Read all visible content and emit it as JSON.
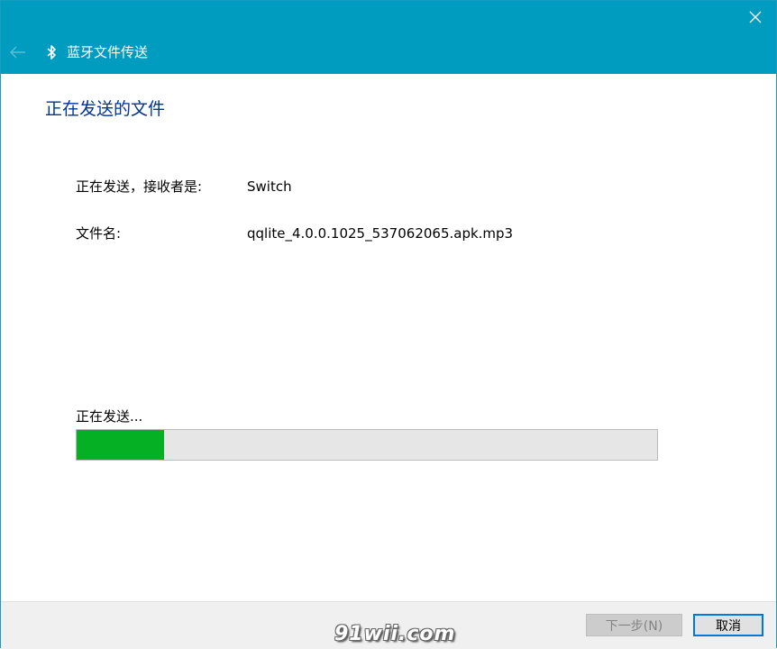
{
  "window": {
    "title": "蓝牙文件传送",
    "accent_color": "#009cc0"
  },
  "header": {
    "back_icon": "back-arrow-icon",
    "bluetooth_icon": "bluetooth-icon",
    "close_icon": "close-icon"
  },
  "main": {
    "heading": "正在发送的文件",
    "recipient_label": "正在发送，接收者是:",
    "recipient_value": "Switch",
    "filename_label": "文件名:",
    "filename_value": "qqlite_4.0.0.1025_537062065.apk.mp3"
  },
  "progress": {
    "label": "正在发送...",
    "percent": 15,
    "fill_color": "#06b025"
  },
  "footer": {
    "next_label": "下一步(N)",
    "cancel_label": "取消"
  },
  "watermark": {
    "text": "91wii.com"
  }
}
